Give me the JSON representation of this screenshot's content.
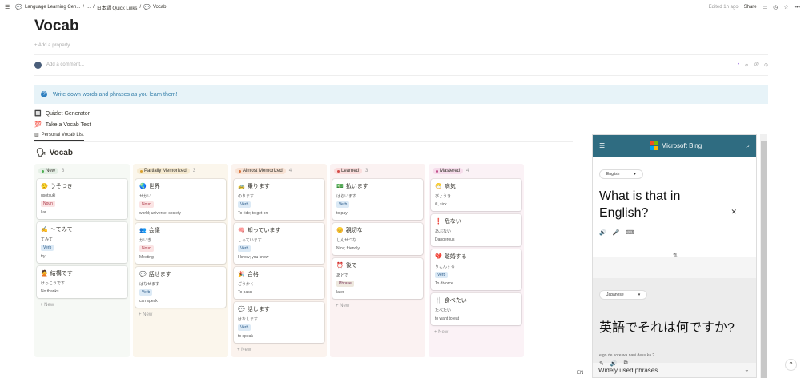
{
  "topbar": {
    "crumb1": "Language Learning Cen...",
    "sep": "/",
    "crumb2": "...",
    "crumb3": "日本語 Quick Links",
    "crumb4": "Vocab",
    "edited": "Edited 1h ago",
    "share": "Share"
  },
  "page": {
    "title": "Vocab",
    "add_property": "Add a property",
    "add_comment": "Add a comment...",
    "callout": "Write down words and phrases as you learn them!",
    "links": [
      {
        "icon": "🔲",
        "label": "Quizlet Generator"
      },
      {
        "icon": "💯",
        "label": "Take a Vocab Test"
      }
    ]
  },
  "db": {
    "tab": "Personal Vocab List",
    "title": "Vocab",
    "new_label": "New"
  },
  "colors": {
    "new": "#f6f9f5",
    "partial": "#fbf6ec",
    "almost": "#fbf3ee",
    "learned": "#fbf2f2",
    "mastered": "#fbf2f6"
  },
  "columns": [
    {
      "name": "New",
      "count": "3",
      "dot": "#4caf50",
      "pill": "#e4efe5",
      "bg": "#f6f9f5",
      "cards": [
        {
          "icon": "🤥",
          "title": "うそつき",
          "reading": "usotsuki",
          "tag": "Noun",
          "tagc": "noun",
          "meaning": "liar"
        },
        {
          "icon": "✍",
          "title": "～てみて",
          "reading": "てみて",
          "tag": "Verb",
          "tagc": "verb",
          "meaning": "try"
        },
        {
          "icon": "🙅",
          "title": "結構です",
          "reading": "けっこうです",
          "tag": "",
          "tagc": "",
          "meaning": "No thanks"
        }
      ]
    },
    {
      "name": "Partially Memorized",
      "count": "3",
      "dot": "#d9a030",
      "pill": "#f6ead0",
      "bg": "#fbf6ec",
      "cards": [
        {
          "icon": "🌏",
          "title": "世界",
          "reading": "せかい",
          "tag": "Noun",
          "tagc": "noun",
          "meaning": "world; universe; society"
        },
        {
          "icon": "👥",
          "title": "会議",
          "reading": "かいぎ",
          "tag": "Noun",
          "tagc": "noun",
          "meaning": "Meeting"
        },
        {
          "icon": "💬",
          "title": "話せます",
          "reading": "はなせます",
          "tag": "Verb",
          "tagc": "verb",
          "meaning": "can speak"
        }
      ]
    },
    {
      "name": "Almost Memorized",
      "count": "4",
      "dot": "#d9733c",
      "pill": "#f8e2d4",
      "bg": "#fbf3ee",
      "cards": [
        {
          "icon": "🚕",
          "title": "乗ります",
          "reading": "のります",
          "tag": "Verb",
          "tagc": "verb",
          "meaning": "To ride; to get on"
        },
        {
          "icon": "🧠",
          "title": "知っています",
          "reading": "しっています",
          "tag": "Verb",
          "tagc": "verb",
          "meaning": "I know; you know"
        },
        {
          "icon": "🎉",
          "title": "合格",
          "reading": "ごうかく",
          "tag": "",
          "tagc": "",
          "meaning": "To pass"
        },
        {
          "icon": "💬",
          "title": "話します",
          "reading": "はなします",
          "tag": "Verb",
          "tagc": "verb",
          "meaning": "to speak"
        }
      ]
    },
    {
      "name": "Learned",
      "count": "3",
      "dot": "#d44c47",
      "pill": "#fadcdc",
      "bg": "#fbf2f2",
      "cards": [
        {
          "icon": "💵",
          "title": "払います",
          "reading": "はらいます",
          "tag": "Verb",
          "tagc": "verb",
          "meaning": "to pay"
        },
        {
          "icon": "😊",
          "title": "親切な",
          "reading": "しんせつな",
          "tag": "",
          "tagc": "",
          "meaning": "Nice; friendly"
        },
        {
          "icon": "⏰",
          "title": "後で",
          "reading": "あとで",
          "tag": "Phrase",
          "tagc": "phrase",
          "meaning": "later"
        }
      ]
    },
    {
      "name": "Mastered",
      "count": "4",
      "dot": "#c14c8a",
      "pill": "#f6dceb",
      "bg": "#fbf2f6",
      "cards": [
        {
          "icon": "😷",
          "title": "病気",
          "reading": "びょうき",
          "tag": "",
          "tagc": "",
          "meaning": "ill, sick"
        },
        {
          "icon": "❗",
          "title": "危ない",
          "reading": "あぶない",
          "tag": "",
          "tagc": "",
          "meaning": "Dangerous"
        },
        {
          "icon": "💔",
          "title": "離婚する",
          "reading": "りこんする",
          "tag": "Verb",
          "tagc": "verb",
          "meaning": "To divorce"
        },
        {
          "icon": "🍴",
          "title": "食べたい",
          "reading": "たべたい",
          "tag": "",
          "tagc": "",
          "meaning": "to want to eat"
        }
      ]
    }
  ],
  "bing": {
    "brand": "Microsoft Bing",
    "src_lang": "English",
    "src_text": "What is that in English?",
    "tgt_lang": "Japanese",
    "tgt_text": "英語でそれは何ですか?",
    "romaji": "eigo de sore wa nani desu ka ?",
    "widely": "Widely used phrases",
    "en": "EN"
  }
}
